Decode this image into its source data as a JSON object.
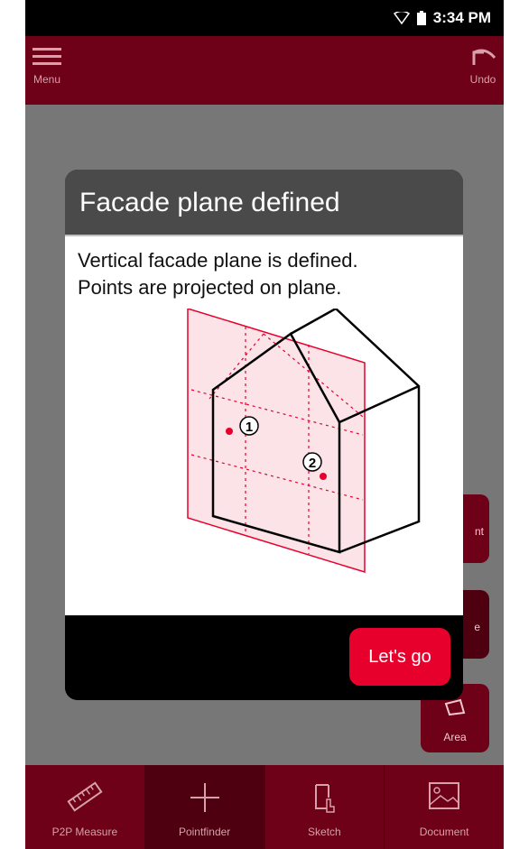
{
  "status_bar": {
    "time": "3:34 PM"
  },
  "top_bar": {
    "menu_label": "Menu",
    "undo_label": "Undo"
  },
  "side_buttons": [
    {
      "label": "nt"
    },
    {
      "label": "e"
    },
    {
      "label": "Area"
    }
  ],
  "bottom_nav": [
    {
      "label": "P2P Measure",
      "icon": "ruler-icon"
    },
    {
      "label": "Pointfinder",
      "icon": "plus-icon",
      "active": true
    },
    {
      "label": "Sketch",
      "icon": "sketch-icon"
    },
    {
      "label": "Document",
      "icon": "image-icon"
    }
  ],
  "dialog": {
    "title": "Facade plane defined",
    "line1": "Vertical facade plane is defined.",
    "line2": "Points are projected on plane.",
    "button": "Let's go",
    "point_labels": [
      "1",
      "2"
    ]
  },
  "colors": {
    "brand": "#6e0018",
    "accent": "#e8002d"
  }
}
